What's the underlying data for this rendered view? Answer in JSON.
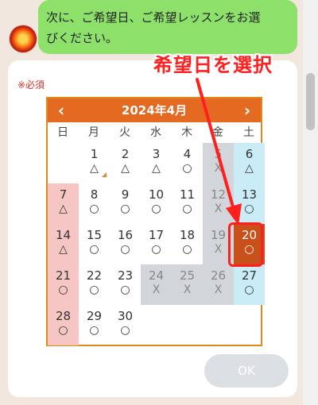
{
  "chat": {
    "message": "次に、ご希望日、ご希望レッスンをお選\nびください。"
  },
  "form": {
    "required_label": "※必須",
    "ok_label": "OK"
  },
  "annotation": {
    "text": "希望日を選択"
  },
  "calendar": {
    "title": "2024年4月",
    "prev_icon": "‹",
    "next_icon": "›",
    "weekdays": [
      "日",
      "月",
      "火",
      "水",
      "木",
      "金",
      "土"
    ],
    "days": [
      {
        "date": "1",
        "mark": "△"
      },
      {
        "date": "2",
        "mark": "△"
      },
      {
        "date": "3",
        "mark": "△"
      },
      {
        "date": "4",
        "mark": "○"
      },
      {
        "date": "5",
        "mark": "X"
      },
      {
        "date": "6",
        "mark": "△"
      },
      {
        "date": "7",
        "mark": "△"
      },
      {
        "date": "8",
        "mark": "○"
      },
      {
        "date": "9",
        "mark": "○"
      },
      {
        "date": "10",
        "mark": "○"
      },
      {
        "date": "11",
        "mark": "○"
      },
      {
        "date": "12",
        "mark": "X"
      },
      {
        "date": "13",
        "mark": "○"
      },
      {
        "date": "14",
        "mark": "△"
      },
      {
        "date": "15",
        "mark": "○"
      },
      {
        "date": "16",
        "mark": "○"
      },
      {
        "date": "17",
        "mark": "○"
      },
      {
        "date": "18",
        "mark": "○"
      },
      {
        "date": "19",
        "mark": "X"
      },
      {
        "date": "20",
        "mark": "○"
      },
      {
        "date": "21",
        "mark": "○"
      },
      {
        "date": "22",
        "mark": "○"
      },
      {
        "date": "23",
        "mark": "○"
      },
      {
        "date": "24",
        "mark": "X"
      },
      {
        "date": "25",
        "mark": "X"
      },
      {
        "date": "26",
        "mark": "X"
      },
      {
        "date": "27",
        "mark": "○"
      },
      {
        "date": "28",
        "mark": "○"
      },
      {
        "date": "29",
        "mark": "○"
      },
      {
        "date": "30",
        "mark": "○"
      }
    ]
  }
}
